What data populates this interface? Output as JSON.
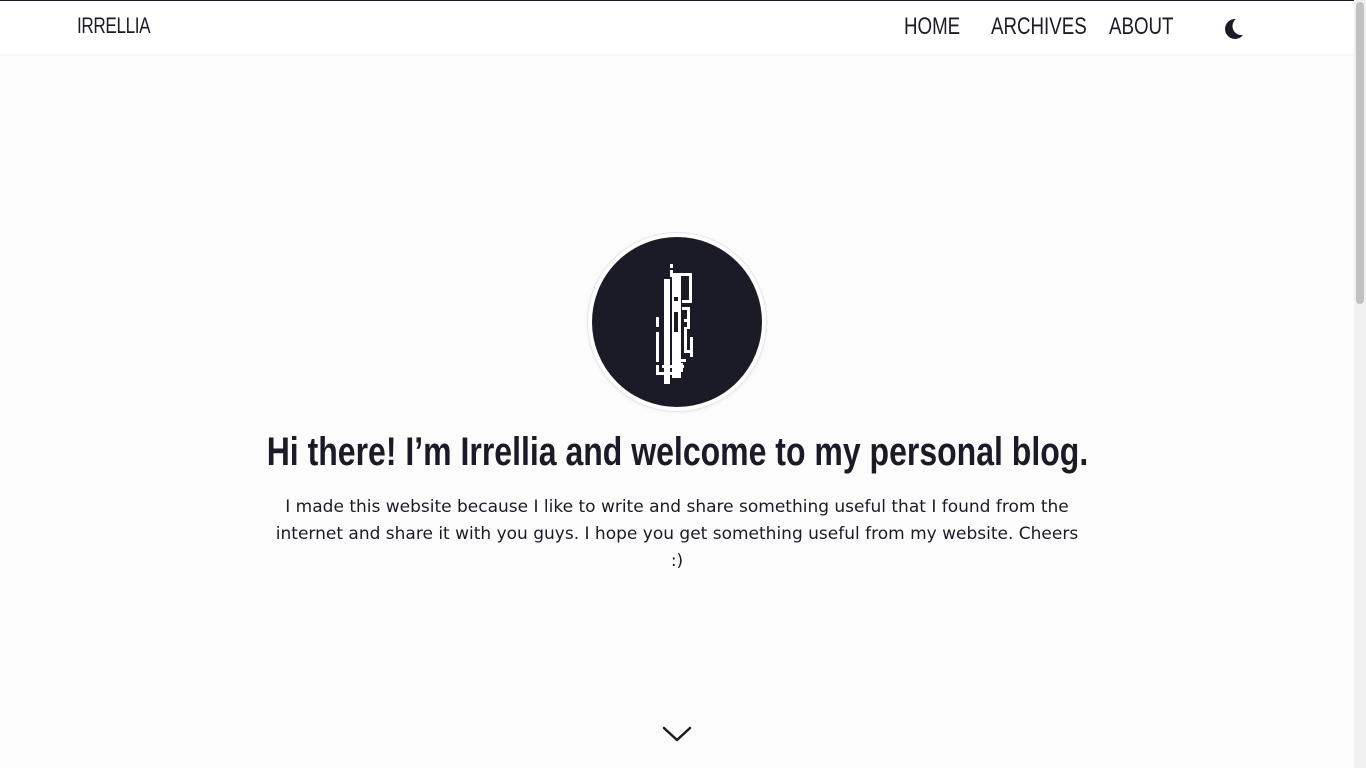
{
  "navbar": {
    "brand": "IRRELLIA",
    "links": [
      {
        "label": "HOME"
      },
      {
        "label": "ARCHIVES"
      },
      {
        "label": "ABOUT"
      }
    ],
    "theme_toggle_icon": "moon-icon"
  },
  "hero": {
    "title": "Hi there! I’m Irrellia and welcome to my personal blog.",
    "description": "I made this website because I like to write and share something useful that I found from the internet and share it with you guys. I hope you get something useful from my website. Cheers :)",
    "avatar_icon": "pixel-logo-icon",
    "scroll_icon": "chevron-down-icon"
  },
  "colors": {
    "text": "#1a1b26",
    "background": "#fdfcfc",
    "avatar_background": "#1a1b26"
  }
}
